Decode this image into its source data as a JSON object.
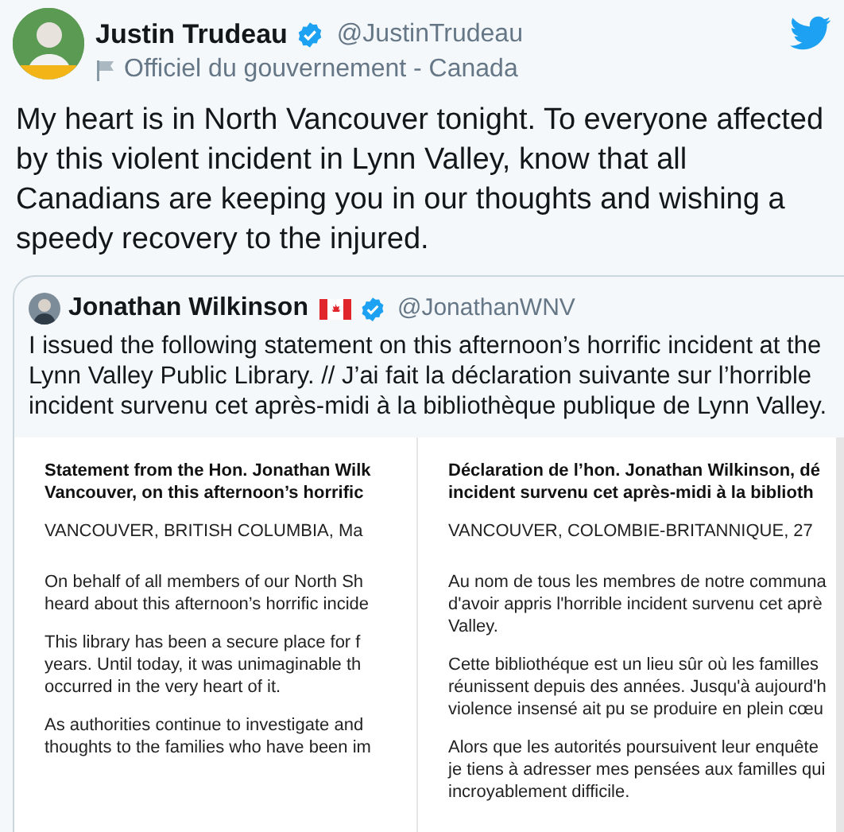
{
  "tweet": {
    "author": {
      "name": "Justin Trudeau",
      "verified": true,
      "handle": "@JustinTrudeau",
      "label": "Officiel du gouvernement - Canada"
    },
    "text": "My heart is in North Vancouver tonight. To everyone affected by this violent incident in Lynn Valley, know that all Canadians are keeping you in our thoughts and wishing a speedy recovery to the injured.",
    "quoted": {
      "author": {
        "name": "Jonathan Wilkinson",
        "verified": true,
        "handle": "@JonathanWNV"
      },
      "text": "I issued the following statement on this afternoon’s horrific incident at the Lynn Valley Public Library. // J’ai fait la déclaration suivante sur l’horrible incident survenu cet après-midi à la bibliothèque publique de Lynn Valley.",
      "document": {
        "columns": [
          {
            "blocks": [
              {
                "kind": "heading",
                "lines": [
                  "Statement from the Hon. Jonathan Wilk",
                  "Vancouver, on this afternoon’s horrific"
                ]
              },
              {
                "kind": "dateline",
                "lines": [
                  "VANCOUVER, BRITISH COLUMBIA, Ma"
                ]
              },
              {
                "kind": "paragraph",
                "lines": [
                  "On behalf of all members of our North Sh",
                  "heard about this afternoon’s horrific incide"
                ]
              },
              {
                "kind": "paragraph",
                "lines": [
                  "This library has been a secure place for f",
                  "years. Until today, it was unimaginable th",
                  "occurred in the very heart of it."
                ]
              },
              {
                "kind": "paragraph",
                "lines": [
                  "As authorities continue to investigate and",
                  "thoughts to the families who have been im"
                ]
              }
            ]
          },
          {
            "blocks": [
              {
                "kind": "heading",
                "lines": [
                  "Déclaration de l’hon. Jonathan Wilkinson, dé",
                  "incident survenu cet après-midi à la biblioth"
                ]
              },
              {
                "kind": "dateline",
                "lines": [
                  "VANCOUVER, COLOMBIE-BRITANNIQUE, 27"
                ]
              },
              {
                "kind": "paragraph",
                "lines": [
                  "Au nom de tous les membres de notre communa",
                  "d'avoir appris l'horrible incident survenu cet aprè",
                  "Valley."
                ]
              },
              {
                "kind": "paragraph",
                "lines": [
                  "Cette bibliothéque est un lieu sûr où les familles",
                  "réunissent depuis des années. Jusqu'à aujourd'h",
                  "violence insensé ait pu se produire en plein cœu"
                ]
              },
              {
                "kind": "paragraph",
                "lines": [
                  "Alors que les autorités poursuivent leur enquête",
                  "je tiens à adresser mes pensées aux familles qui",
                  "incroyablement difficile."
                ]
              }
            ]
          }
        ]
      }
    }
  }
}
